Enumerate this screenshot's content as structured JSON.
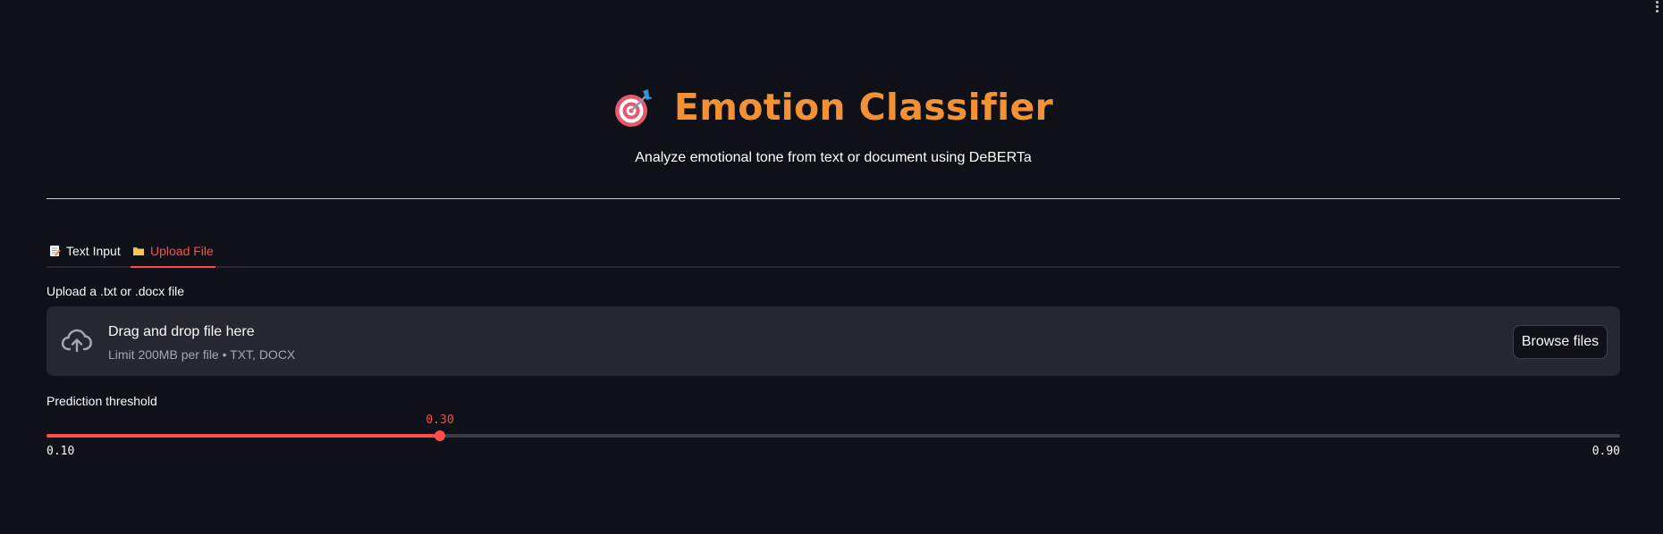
{
  "header": {
    "title": "Emotion Classifier",
    "title_icon": "direct-hit-target-icon",
    "subtitle": "Analyze emotional tone from text or document using DeBERTa",
    "title_color": "#f29135"
  },
  "tabs": [
    {
      "label": "Text Input",
      "icon": "memo-icon",
      "active": false
    },
    {
      "label": "Upload File",
      "icon": "folder-icon",
      "active": true
    }
  ],
  "uploader": {
    "label": "Upload a .txt or .docx file",
    "drop_text": "Drag and drop file here",
    "limit_text": "Limit 200MB per file • TXT, DOCX",
    "button_label": "Browse files",
    "icon": "cloud-upload-icon"
  },
  "threshold": {
    "label": "Prediction threshold",
    "value": 0.3,
    "value_text": "0.30",
    "min": 0.1,
    "max": 0.9,
    "min_text": "0.10",
    "max_text": "0.90"
  },
  "colors": {
    "background": "#0e1117",
    "accent": "#ff4b4b",
    "panel": "#262730"
  }
}
